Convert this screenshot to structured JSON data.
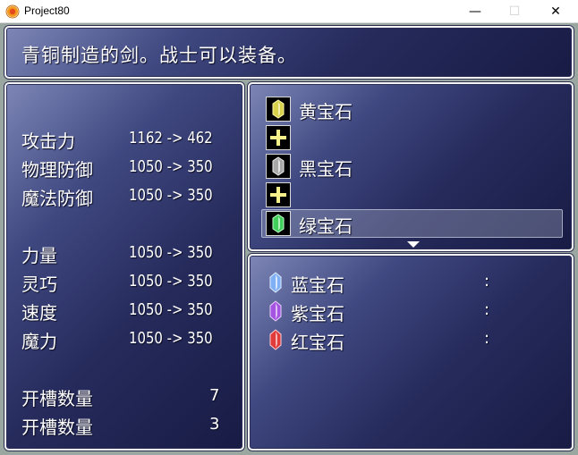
{
  "window": {
    "title": "Project80",
    "minimize_glyph": "—",
    "maximize_glyph": "☐",
    "close_glyph": "✕"
  },
  "help": {
    "text": "青铜制造的剑。战士可以装备。"
  },
  "status": {
    "stats": [
      {
        "label": "攻击力",
        "value": "1162 -> 462"
      },
      {
        "label": "物理防御",
        "value": "1050 -> 350"
      },
      {
        "label": "魔法防御",
        "value": "1050 -> 350"
      },
      {
        "label": "力量",
        "value": "1050 -> 350"
      },
      {
        "label": "灵巧",
        "value": "1050 -> 350"
      },
      {
        "label": "速度",
        "value": "1050 -> 350"
      },
      {
        "label": "魔力",
        "value": "1050 -> 350"
      }
    ],
    "slots": [
      {
        "label": "开槽数量",
        "value": "7"
      },
      {
        "label": "开槽数量",
        "value": "3"
      }
    ]
  },
  "socket": {
    "slots": [
      {
        "name": "黄宝石",
        "gem_color": "#d8d24a"
      },
      {
        "name": "黑宝石",
        "gem_color": "#a8a8a8"
      },
      {
        "name": "绿宝石",
        "gem_color": "#3fcf5a"
      }
    ],
    "plus_glyph": "+",
    "selected_index": 2
  },
  "inventory": {
    "items": [
      {
        "name": "蓝宝石",
        "colon": ":",
        "gem_color": "#7fb0f5"
      },
      {
        "name": "紫宝石",
        "colon": ":",
        "gem_color": "#a454e0"
      },
      {
        "name": "红宝石",
        "colon": ":",
        "gem_color": "#e03a3a"
      }
    ]
  }
}
